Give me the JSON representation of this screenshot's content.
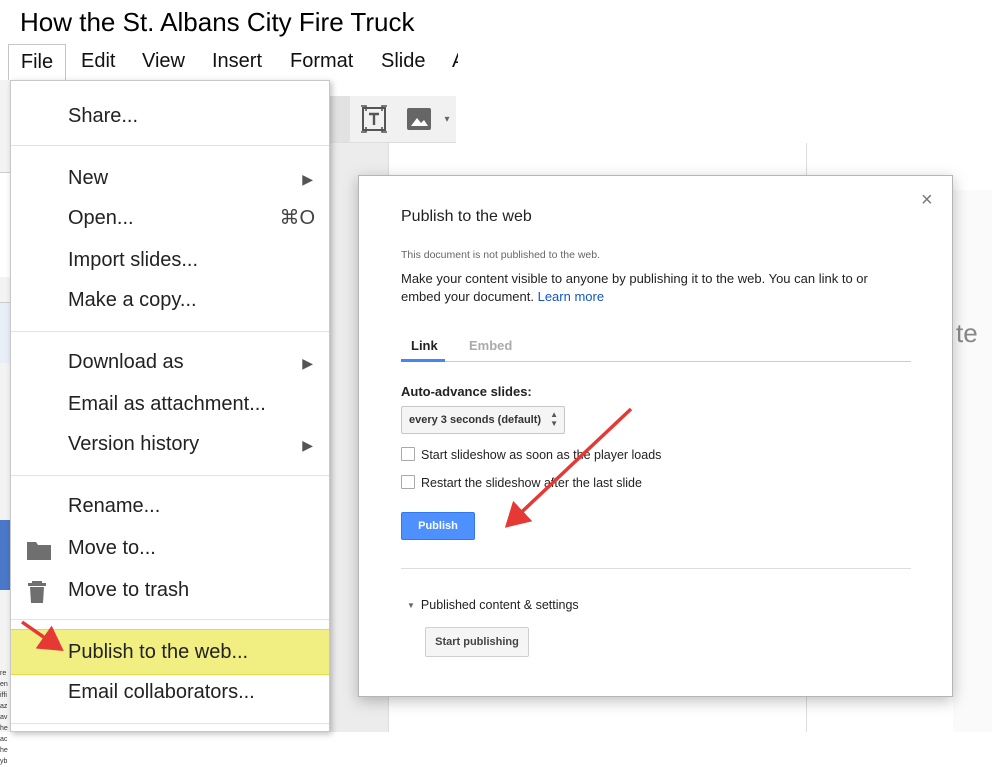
{
  "document": {
    "title": "How the St. Albans City Fire Truck"
  },
  "menubar": {
    "items": [
      {
        "label": "File",
        "name": "menu-file"
      },
      {
        "label": "Edit",
        "name": "menu-edit"
      },
      {
        "label": "View",
        "name": "menu-view"
      },
      {
        "label": "Insert",
        "name": "menu-insert"
      },
      {
        "label": "Format",
        "name": "menu-format"
      },
      {
        "label": "Slide",
        "name": "menu-slide"
      }
    ]
  },
  "toolbar": {
    "icons": [
      "textbox-icon",
      "image-icon"
    ]
  },
  "file_menu": {
    "items": [
      {
        "label": "Share...",
        "name": "menu-share"
      },
      {
        "label": "New",
        "name": "menu-new",
        "submenu": true
      },
      {
        "label": "Open...",
        "name": "menu-open",
        "shortcut": "⌘O"
      },
      {
        "label": "Import slides...",
        "name": "menu-import-slides"
      },
      {
        "label": "Make a copy...",
        "name": "menu-make-copy"
      },
      {
        "label": "Download as",
        "name": "menu-download-as",
        "submenu": true
      },
      {
        "label": "Email as attachment...",
        "name": "menu-email-attachment"
      },
      {
        "label": "Version history",
        "name": "menu-version-history",
        "submenu": true
      },
      {
        "label": "Rename...",
        "name": "menu-rename"
      },
      {
        "label": "Move to...",
        "name": "menu-move-to",
        "icon": "folder-icon"
      },
      {
        "label": "Move to trash",
        "name": "menu-move-to-trash",
        "icon": "trash-icon"
      },
      {
        "label": "Publish to the web...",
        "name": "menu-publish-to-web",
        "highlighted": true
      },
      {
        "label": "Email collaborators...",
        "name": "menu-email-collaborators"
      }
    ],
    "submenu_glyph": "▶"
  },
  "publish_dialog": {
    "title": "Publish to the web",
    "close_glyph": "×",
    "status": "This document is not published to the web.",
    "description": "Make your content visible to anyone by publishing it to the web. You can link to or embed your document.",
    "learn_more": "Learn more",
    "tabs": [
      {
        "label": "Link",
        "active": true
      },
      {
        "label": "Embed",
        "active": false
      }
    ],
    "auto_advance_label": "Auto-advance slides:",
    "auto_advance_value": "every 3 seconds (default)",
    "checkboxes": [
      {
        "label": "Start slideshow as soon as the player loads",
        "checked": false
      },
      {
        "label": "Restart the slideshow after the last slide",
        "checked": false
      }
    ],
    "publish_button": "Publish",
    "published_settings_label": "Published content & settings",
    "start_publishing_button": "Start publishing"
  },
  "left_strip_text": "re\nen\niffi\naz\nav\nhe\nac\nhe\nyb",
  "background_fragment": "te",
  "colors": {
    "accent_blue": "#4d90fe",
    "link_blue": "#1155cc",
    "highlight_yellow": "#f2ef82",
    "annotation_arrow": "#e53935"
  }
}
